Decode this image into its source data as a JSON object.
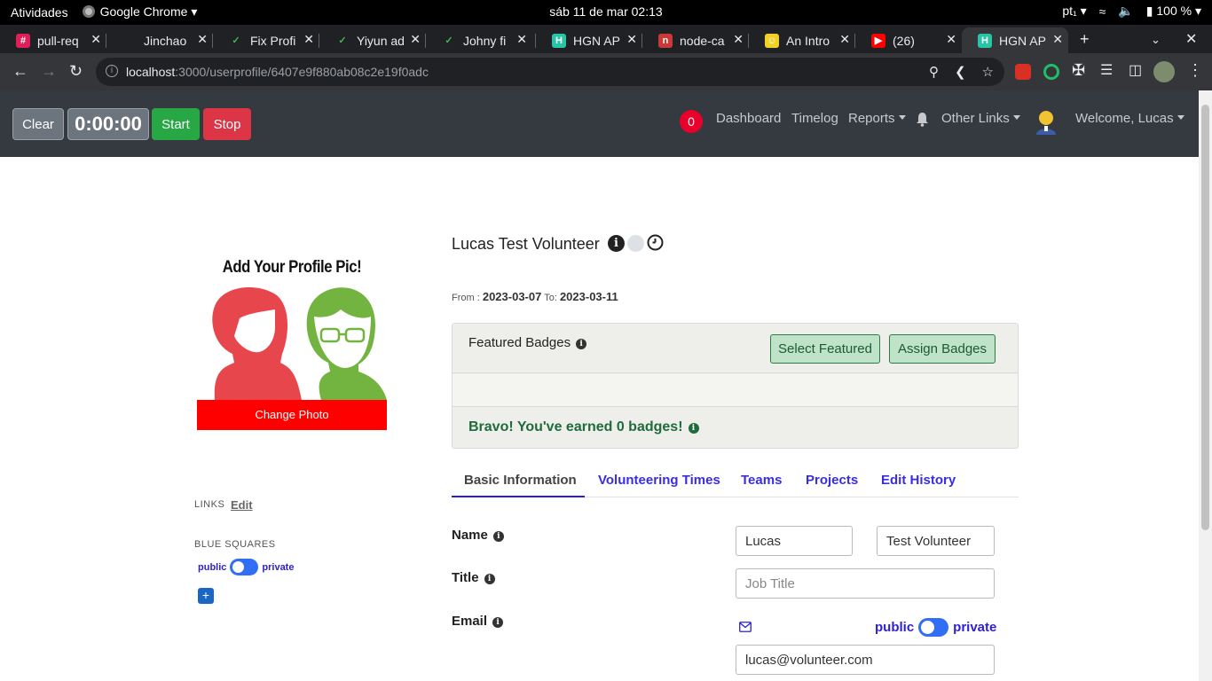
{
  "system_bar": {
    "activities": "Atividades",
    "app_name": "Google Chrome",
    "clock": "sáb 11 de mar  02:13",
    "keyboard": "pt₁",
    "battery": "100 %"
  },
  "tabs": [
    {
      "label": "pull-req",
      "favicon": "slack-icon",
      "color": "#e01e5a"
    },
    {
      "label": "Jinchao",
      "favicon": "blank",
      "color": "#202124"
    },
    {
      "label": "Fix Profi",
      "favicon": "check-icon",
      "color": "#3fb950"
    },
    {
      "label": "Yiyun ad",
      "favicon": "check-icon",
      "color": "#3fb950"
    },
    {
      "label": "Johny fi",
      "favicon": "check-icon",
      "color": "#3fb950"
    },
    {
      "label": "HGN AP",
      "favicon": "hgn-icon",
      "color": "#27c4a8"
    },
    {
      "label": "node-ca",
      "favicon": "npm-icon",
      "color": "#cb3837"
    },
    {
      "label": "An Intro",
      "favicon": "smile-icon",
      "color": "#f2d024"
    },
    {
      "label": "(26) ",
      "favicon": "youtube-icon",
      "color": "#ff0000"
    },
    {
      "label": "HGN AP",
      "favicon": "hgn-icon",
      "color": "#27c4a8",
      "active": true
    }
  ],
  "omnibox": {
    "host": "localhost",
    "path": ":3000/userprofile/6407e9f880ab08c2e19f0adc"
  },
  "timer": {
    "clear": "Clear",
    "display": "0:00:00",
    "start": "Start",
    "stop": "Stop"
  },
  "nav": {
    "notifications": "0",
    "dashboard": "Dashboard",
    "timelog": "Timelog",
    "reports": "Reports",
    "other_links": "Other Links",
    "welcome": "Welcome, Lucas"
  },
  "profile": {
    "pic_title": "Add Your Profile Pic!",
    "change_photo": "Change Photo",
    "links_label": "LINKS",
    "links_edit": "Edit",
    "blue_squares_label": "BLUE SQUARES",
    "public": "public",
    "private": "private",
    "add": "+",
    "name": "Lucas Test Volunteer",
    "from_label": "From :",
    "from_date": "2023-03-07",
    "to_label": "To:",
    "to_date": "2023-03-11"
  },
  "badges": {
    "featured_title": "Featured Badges",
    "select_featured": "Select Featured",
    "assign_badges": "Assign Badges",
    "earned": "Bravo! You've earned 0 badges!"
  },
  "profile_tabs": [
    "Basic Information",
    "Volunteering Times",
    "Teams",
    "Projects",
    "Edit History"
  ],
  "form": {
    "name_label": "Name",
    "first_name": "Lucas",
    "last_name": "Test Volunteer",
    "title_label": "Title",
    "title_placeholder": "Job Title",
    "email_label": "Email",
    "email_value": "lucas@volunteer.com",
    "public": "public",
    "private": "private"
  },
  "colors": {
    "nav_bg": "#343a40",
    "accent_blue": "#2e1fd3",
    "start_green": "#28a745",
    "stop_red": "#dc3545",
    "change_photo_red": "#ff0000"
  }
}
